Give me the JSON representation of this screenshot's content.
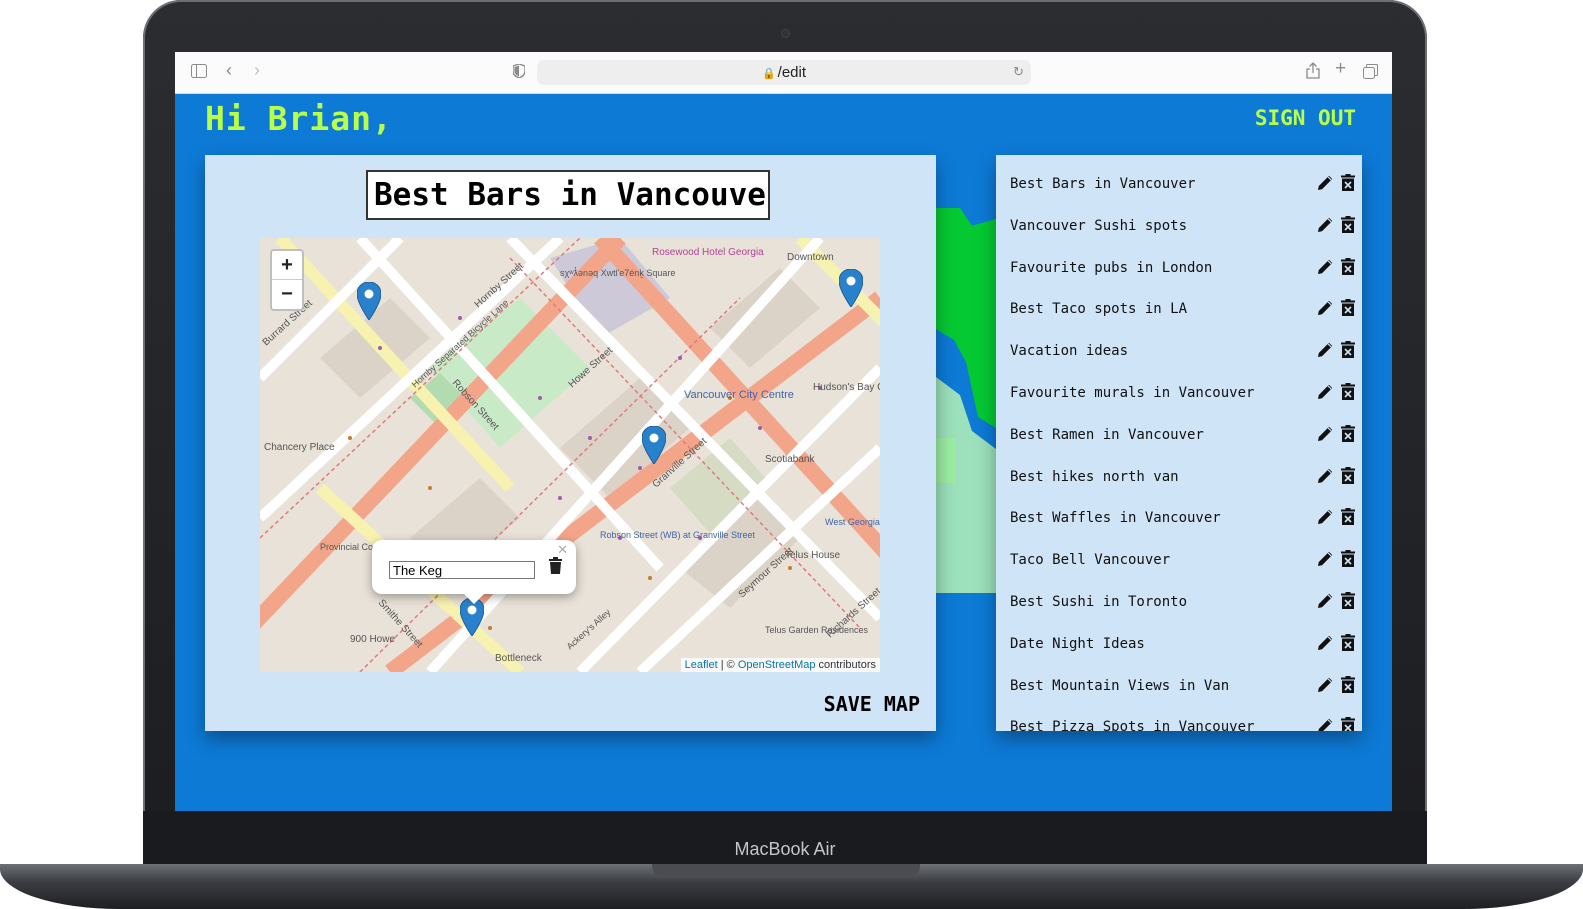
{
  "device": {
    "label": "MacBook Air"
  },
  "browser": {
    "url": "/edit"
  },
  "header": {
    "greeting": "Hi Brian,",
    "sign_out": "SIGN OUT"
  },
  "editor": {
    "map_title": "Best Bars in Vancouve",
    "save_label": "SAVE MAP",
    "popup_value": "The Keg",
    "attribution": {
      "leaflet": "Leaflet",
      "sep": " | © ",
      "osm": "OpenStreetMap",
      "suffix": " contributors"
    },
    "zoom_in": "+",
    "zoom_out": "−",
    "map_labels": [
      "Rosewood Hotel Georgia",
      "Downtown",
      "sχʷƛ̓ənəq Xwtl'e7énḵ Square",
      "Hornby Street",
      "Burrard Street",
      "Hornby Separated Bicycle Lane",
      "Robson Street",
      "Howe Street",
      "Vancouver City Centre",
      "Hudson's Bay Company",
      "Granville Street",
      "Scotiabank",
      "Chancery Place",
      "Provincial Court of British Columbia",
      "Smithe Street",
      "Seymour Street",
      "Telus House",
      "Telus Garden Residences",
      "Richards Street",
      "Bottleneck",
      "Ackery's Alley",
      "Robson Street (WB) at Granville Street",
      "West Georgia Street",
      "900 Howe"
    ]
  },
  "maps_list": [
    "Best Bars in Vancouver",
    "Vancouver Sushi spots",
    "Favourite pubs in London",
    "Best Taco spots in LA",
    "Vacation ideas",
    "Favourite murals in Vancouver",
    "Best Ramen in Vancouver",
    "Best hikes north van",
    "Best Waffles in Vancouver",
    "Taco Bell Vancouver",
    "Best Sushi in Toronto",
    "Date Night Ideas",
    "Best Mountain Views in Van",
    "Best Pizza Spots in Vancouver"
  ],
  "colors": {
    "screen_bg": "#0d7ad6",
    "accent": "#b9ff47",
    "panel_bg": "#cfe4f7",
    "pin": "#2a81cb"
  }
}
